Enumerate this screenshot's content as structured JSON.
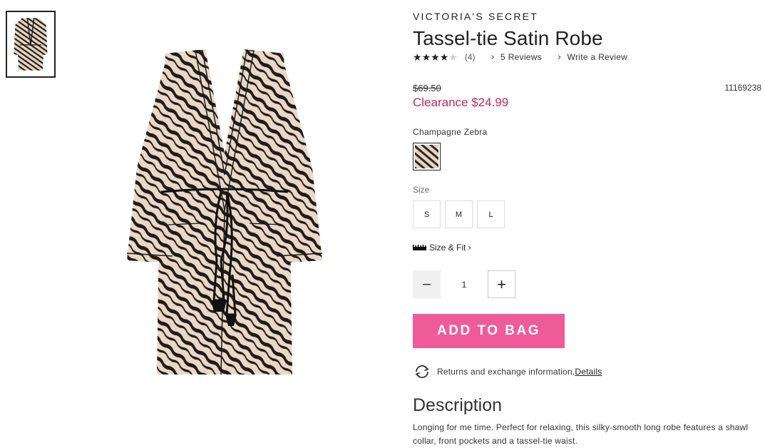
{
  "product": {
    "brand": "VICTORIA'S SECRET",
    "title": "Tassel-tie Satin Robe",
    "rating": {
      "stars": 4,
      "max": 5,
      "count_label": "(4)"
    },
    "reviews_link": "5 Reviews",
    "write_review_link": "Write a Review",
    "original_price": "$69.50",
    "sku": "11169238",
    "clearance_price": "Clearance $24.99",
    "color_name": "Champagne Zebra",
    "size_label": "Size",
    "sizes": [
      "S",
      "M",
      "L"
    ],
    "size_fit_label": "Size & Fit",
    "quantity": "1",
    "add_to_bag_label": "ADD TO BAG",
    "returns_text": "Returns and exchange information.",
    "returns_link": "Details",
    "description_title": "Description",
    "description_text": "Longing for me time. Perfect for relaxing, this silky-smooth long robe features a shawl collar, front pockets and a tassel-tie waist."
  },
  "icons": {
    "star": "star-icon",
    "chevron": "chevron-right-icon",
    "ruler": "ruler-icon",
    "minus": "minus-icon",
    "plus": "plus-icon",
    "returns": "returns-icon"
  },
  "colors": {
    "clearance": "#c8245e",
    "add_to_bag": "#ef5b98",
    "text": "#222222"
  }
}
